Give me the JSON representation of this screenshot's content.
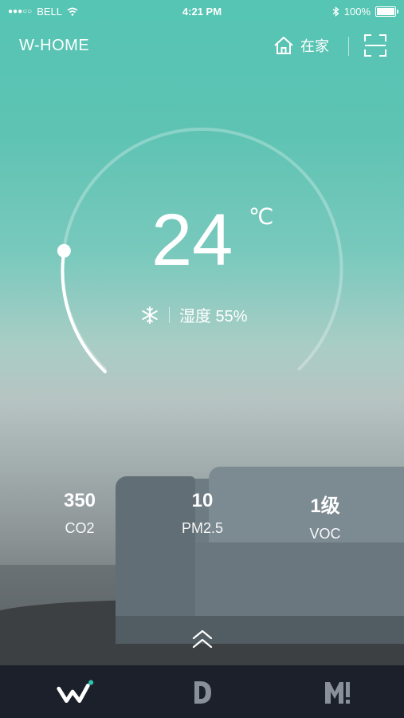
{
  "status_bar": {
    "carrier": "BELL",
    "time": "4:21 PM",
    "battery": "100%",
    "battery_level": 1.0
  },
  "header": {
    "brand": "W-HOME",
    "home_label": "在家"
  },
  "climate": {
    "temperature": "24",
    "unit": "℃",
    "humidity_label": "湿度 55%",
    "mode_icon": "snowflake-icon",
    "setpoint_fraction": 0.2
  },
  "metrics": [
    {
      "value": "350",
      "label": "CO2"
    },
    {
      "value": "10",
      "label": "PM2.5"
    },
    {
      "value": "1级",
      "label": "VOC"
    }
  ],
  "tabs": [
    {
      "icon": "w-logo-icon",
      "active": true
    },
    {
      "icon": "d-logo-icon",
      "active": false
    },
    {
      "icon": "m-logo-icon",
      "active": false
    }
  ],
  "colors": {
    "accent": "#4fc3b1",
    "tabbar": "#1b202b",
    "active_dot": "#2ec4b0"
  }
}
